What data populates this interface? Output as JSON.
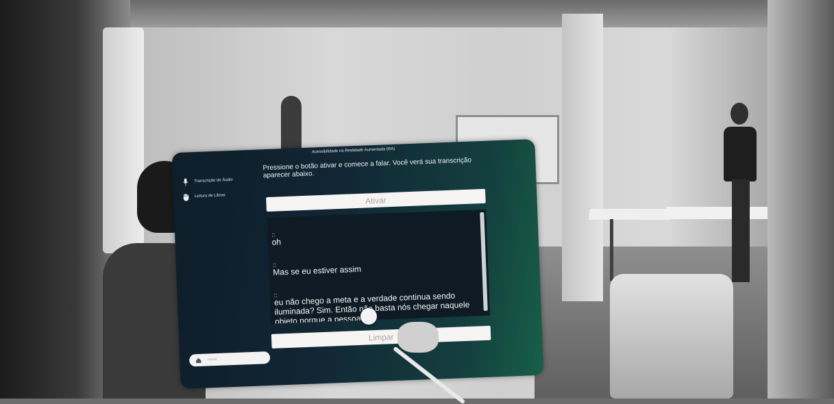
{
  "panel": {
    "title": "Acessibilidade na Realidade Aumentada (RA)",
    "instruction": "Pressione o botão ativar e comece a falar. Você verá sua transcrição aparecer abaixo.",
    "activate_label": "Ativar",
    "clear_label": "Limpar"
  },
  "sidebar": {
    "items": [
      {
        "label": "Transcrição de Áudio",
        "icon": "microphone-icon"
      },
      {
        "label": "Leitura de Libras",
        "icon": "hand-icon"
      }
    ],
    "home": {
      "label": "Home",
      "icon": "home-icon"
    }
  },
  "transcript": {
    "entries": [
      {
        "marker": "::",
        "text": "oh"
      },
      {
        "marker": "::",
        "text": "Mas se eu estiver assim"
      },
      {
        "marker": "::",
        "text": "eu não chego a meta e a verdade continua sendo iluminada? Sim. Então não basta nós chegar naquele objeto porque a pessoa"
      }
    ]
  }
}
